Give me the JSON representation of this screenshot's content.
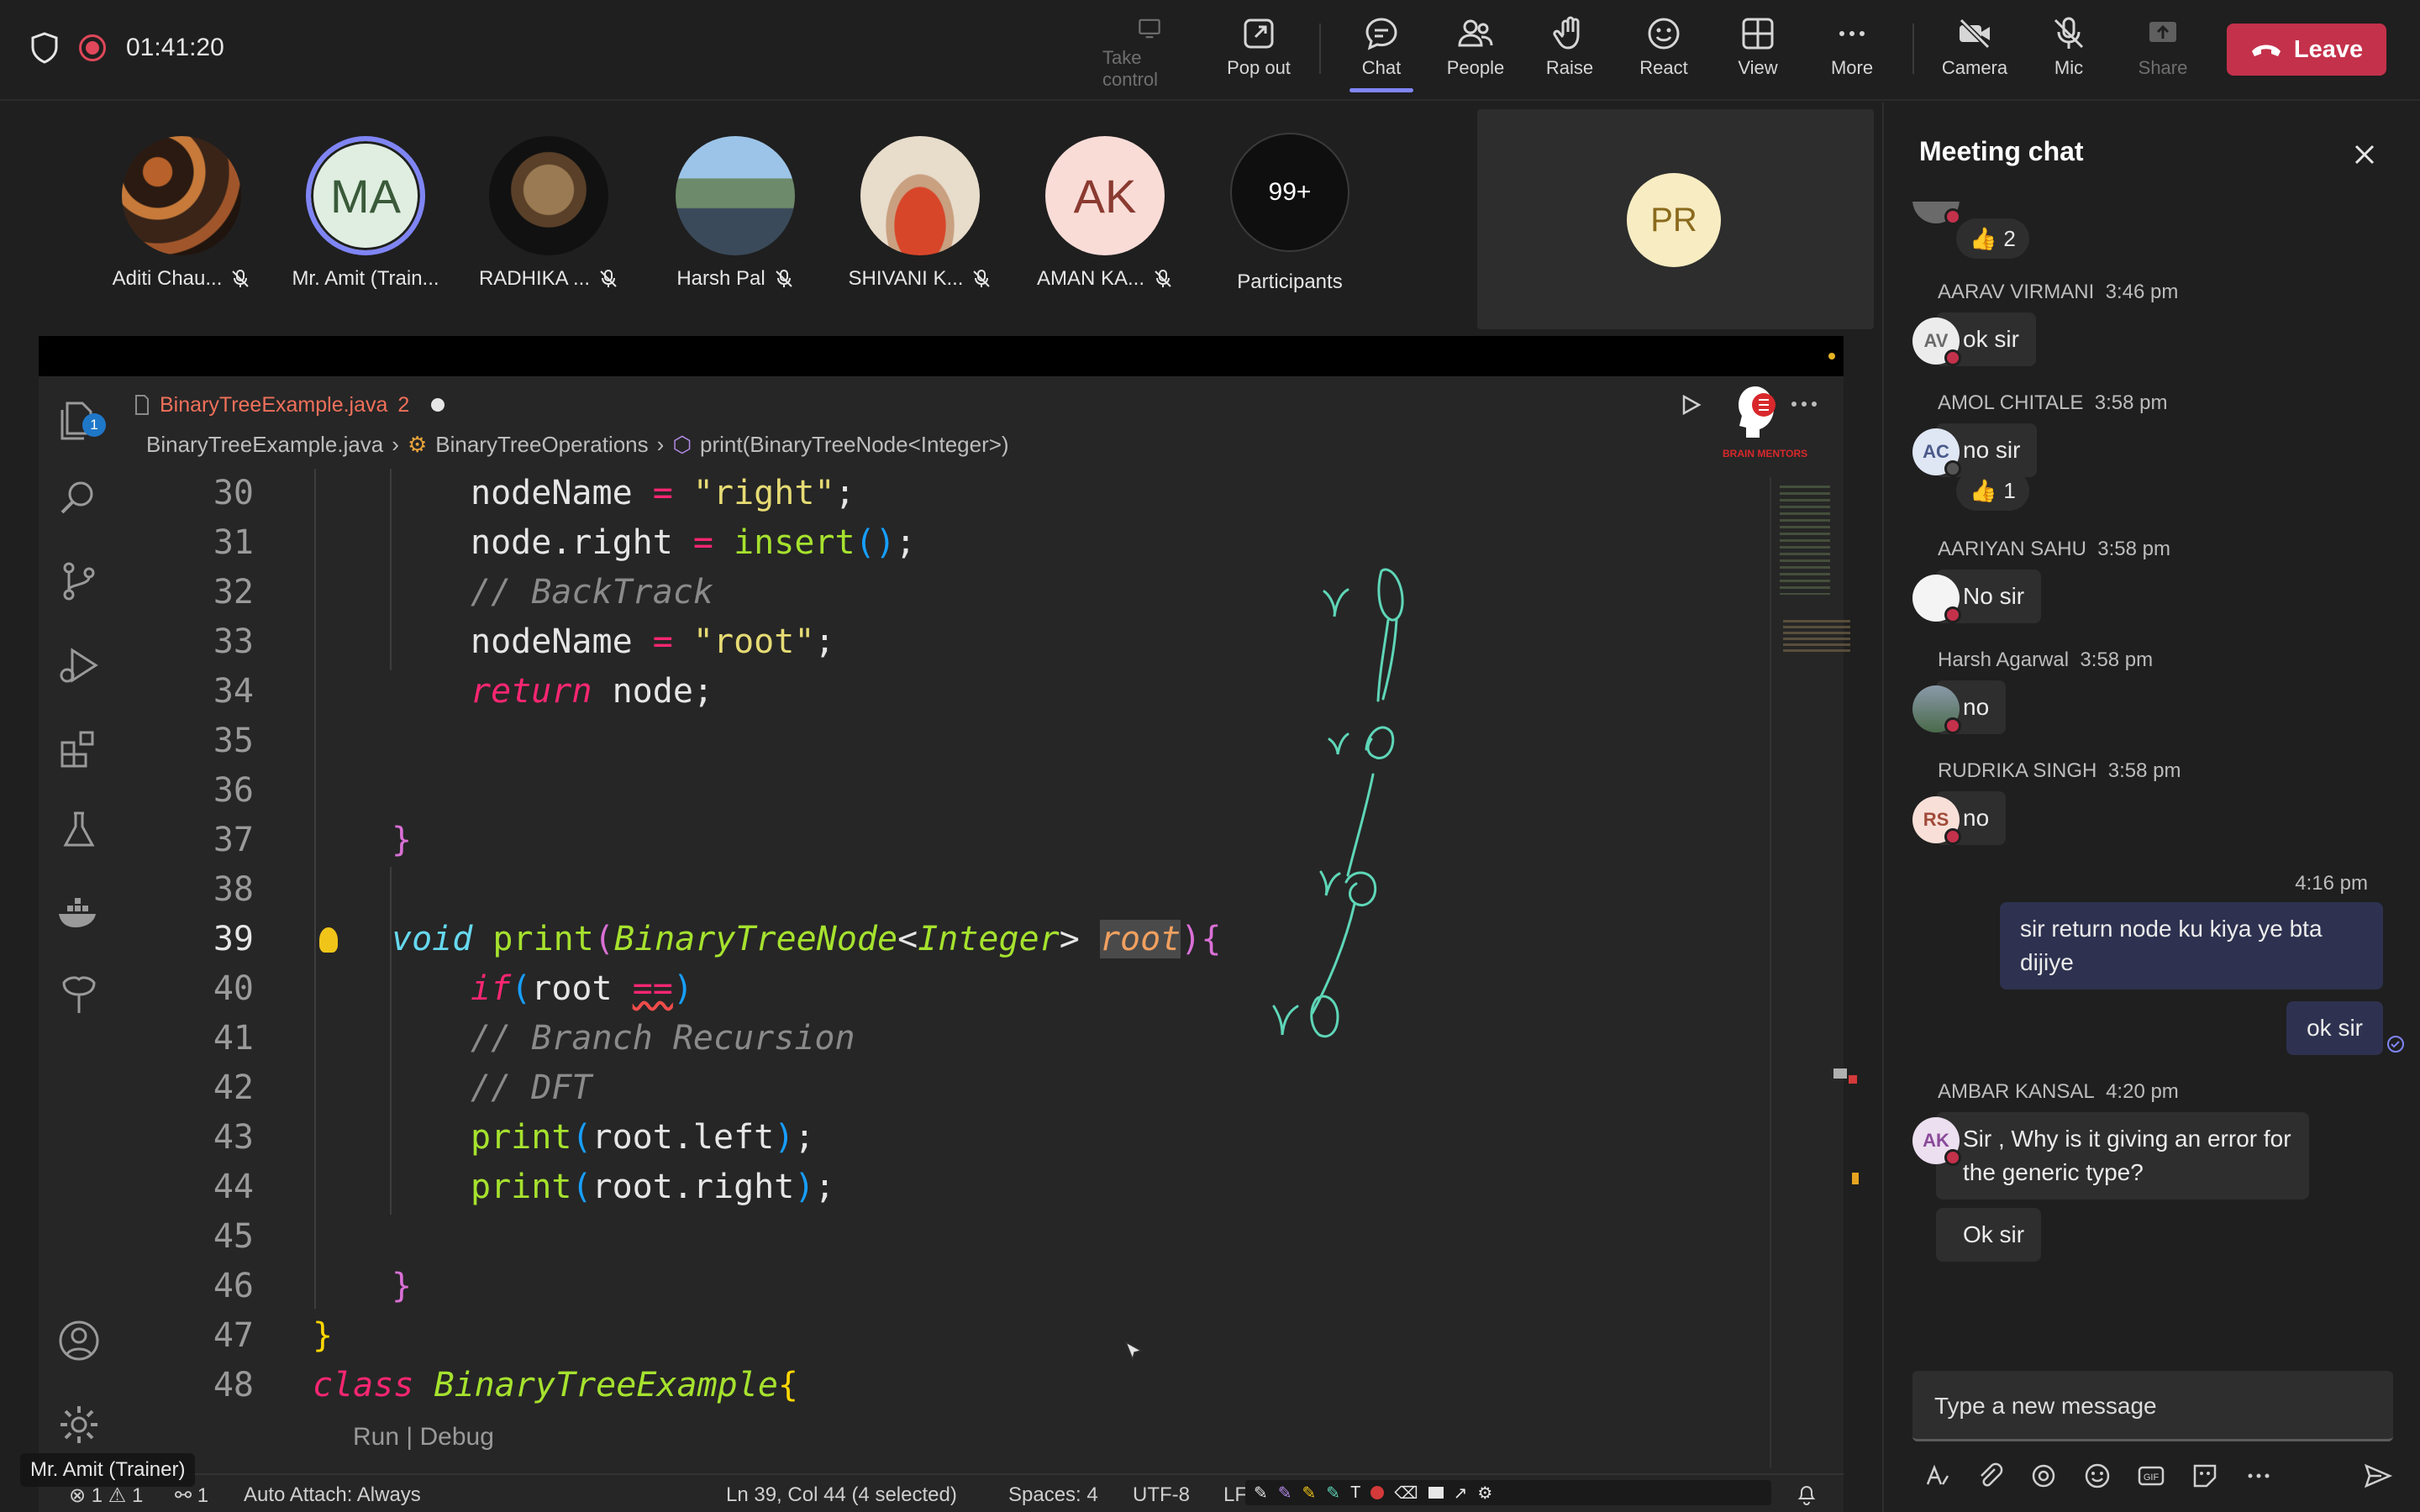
{
  "topbar": {
    "timer": "01:41:20",
    "buttons": {
      "take_control": "Take control",
      "pop_out": "Pop out",
      "chat": "Chat",
      "people": "People",
      "raise": "Raise",
      "react": "React",
      "view": "View",
      "more": "More",
      "camera": "Camera",
      "mic": "Mic",
      "share": "Share"
    },
    "leave": "Leave"
  },
  "participants": [
    {
      "name": "Aditi Chau...",
      "initials": ""
    },
    {
      "name": "Mr. Amit (Train...",
      "initials": "MA"
    },
    {
      "name": "RADHIKA ...",
      "initials": ""
    },
    {
      "name": "Harsh Pal",
      "initials": ""
    },
    {
      "name": "SHIVANI K...",
      "initials": ""
    },
    {
      "name": "AMAN KA...",
      "initials": "AK"
    }
  ],
  "overflow": {
    "count": "99+",
    "label": "Participants"
  },
  "self_tile": {
    "initials": "PR"
  },
  "editor": {
    "explorer_badge": "1",
    "tab_name": "BinaryTreeExample.java",
    "tab_problems": "2",
    "breadcrumb": [
      "BinaryTreeExample.java",
      "BinaryTreeOperations",
      "print(BinaryTreeNode<Integer>)"
    ],
    "brand": "BRAIN MENTORS",
    "lines": [
      "30",
      "31",
      "32",
      "33",
      "34",
      "35",
      "36",
      "37",
      "38",
      "39",
      "40",
      "41",
      "42",
      "43",
      "44",
      "45",
      "46",
      "47",
      "48"
    ],
    "code": {
      "l30": {
        "a": "nodeName",
        "b": " = ",
        "c": "\"right\"",
        "d": ";"
      },
      "l31": {
        "a": "node.right",
        "b": " = ",
        "c": "insert",
        "d": "()",
        "e": ";"
      },
      "l32": "// BackTrack",
      "l33": {
        "a": "nodeName",
        "b": " = ",
        "c": "\"root\"",
        "d": ";"
      },
      "l34": {
        "a": "return",
        "b": " node;"
      },
      "l37": "}",
      "l39": {
        "a": "void",
        "b": "print",
        "c": "(",
        "d": "BinaryTreeNode",
        "e": "<",
        "f": "Integer",
        "g": "> ",
        "h": "root",
        "i": "){"
      },
      "l40": {
        "a": "if",
        "b": "(",
        "c": "root ",
        "d": "==",
        "e": ")"
      },
      "l41": "// Branch Recursion",
      "l42": "// DFT",
      "l43": {
        "a": "print",
        "b": "(",
        "c": "root.left",
        "d": ")",
        "e": ";"
      },
      "l44": {
        "a": "print",
        "b": "(",
        "c": "root.right",
        "d": ")",
        "e": ";"
      },
      "l46": "}",
      "l47": "}",
      "l48": {
        "a": "class",
        "b": "BinaryTreeExample",
        "c": "{"
      }
    },
    "codelens": "Run | Debug",
    "status": {
      "problems": "⊗ 1 ⚠ 1",
      "ports": "⚯ 1",
      "auto_attach": "Auto Attach: Always",
      "position": "Ln 39, Col 44 (4 selected)",
      "spaces": "Spaces: 4",
      "encoding": "UTF-8",
      "eol": "LF"
    }
  },
  "presenter_tag": "Mr. Amit (Trainer)",
  "chat": {
    "title": "Meeting chat",
    "messages": [
      {
        "reaction": "2"
      },
      {
        "sender": "AARAV VIRMANI",
        "time": "3:46 pm",
        "initials": "AV",
        "text": "ok sir"
      },
      {
        "sender": "AMOL CHITALE",
        "time": "3:58 pm",
        "initials": "AC",
        "text": "no sir",
        "reaction": "1"
      },
      {
        "sender": "AARIYAN SAHU",
        "time": "3:58 pm",
        "initials": "",
        "text": "No sir"
      },
      {
        "sender": "Harsh Agarwal",
        "time": "3:58 pm",
        "initials": "",
        "text": "no"
      },
      {
        "sender": "RUDRIKA SINGH",
        "time": "3:58 pm",
        "initials": "RS",
        "text": "no"
      },
      {
        "time": "4:16 pm",
        "text1": "sir return node ku kiya ye bta dijiye",
        "text2": "ok sir"
      },
      {
        "sender": "AMBAR KANSAL",
        "time": "4:20 pm",
        "initials": "AK",
        "text": "Sir , Why is it giving an error for the generic type?",
        "text2": "Ok sir"
      }
    ],
    "compose_placeholder": "Type a new message"
  },
  "colors": {
    "accent": "#7f85f5",
    "leave": "#c4314b",
    "annotation": "#5ed6b8"
  }
}
